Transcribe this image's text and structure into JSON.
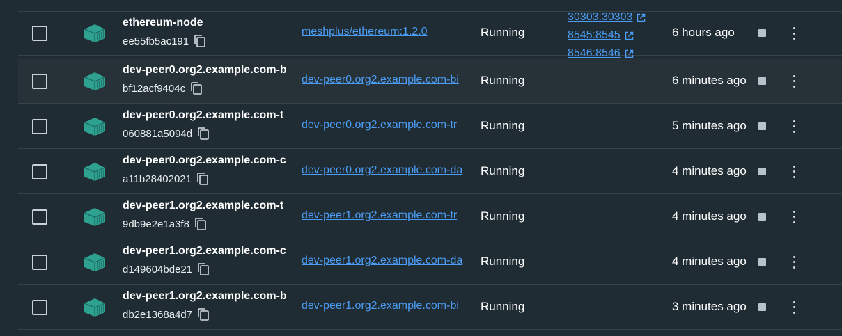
{
  "colors": {
    "background": "#202c33",
    "row_alt": "#263238",
    "link": "#4b9df5",
    "container_icon": "#2ea191"
  },
  "icons": {
    "checkbox": "checkbox-icon",
    "container": "container-icon",
    "copy": "copy-icon",
    "external": "external-link-icon",
    "stop": "stop-icon",
    "menu": "kebab-menu-icon"
  },
  "containers": [
    {
      "name": "ethereum-node",
      "id": "ee55fb5ac191",
      "image": "meshplus/ethereum:1.2.0",
      "status": "Running",
      "ports": [
        "30303:30303",
        "8545:8545",
        "8546:8546"
      ],
      "started": "6 hours ago"
    },
    {
      "name": "dev-peer0.org2.example.com-b",
      "id": "bf12acf9404c",
      "image": "dev-peer0.org2.example.com-bi",
      "status": "Running",
      "ports": [],
      "started": "6 minutes ago"
    },
    {
      "name": "dev-peer0.org2.example.com-t",
      "id": "060881a5094d",
      "image": "dev-peer0.org2.example.com-tr",
      "status": "Running",
      "ports": [],
      "started": "5 minutes ago"
    },
    {
      "name": "dev-peer0.org2.example.com-c",
      "id": "a11b28402021",
      "image": "dev-peer0.org2.example.com-da",
      "status": "Running",
      "ports": [],
      "started": "4 minutes ago"
    },
    {
      "name": "dev-peer1.org2.example.com-t",
      "id": "9db9e2e1a3f8",
      "image": "dev-peer1.org2.example.com-tr",
      "status": "Running",
      "ports": [],
      "started": "4 minutes ago"
    },
    {
      "name": "dev-peer1.org2.example.com-c",
      "id": "d149604bde21",
      "image": "dev-peer1.org2.example.com-da",
      "status": "Running",
      "ports": [],
      "started": "4 minutes ago"
    },
    {
      "name": "dev-peer1.org2.example.com-b",
      "id": "db2e1368a4d7",
      "image": "dev-peer1.org2.example.com-bi",
      "status": "Running",
      "ports": [],
      "started": "3 minutes ago"
    }
  ]
}
